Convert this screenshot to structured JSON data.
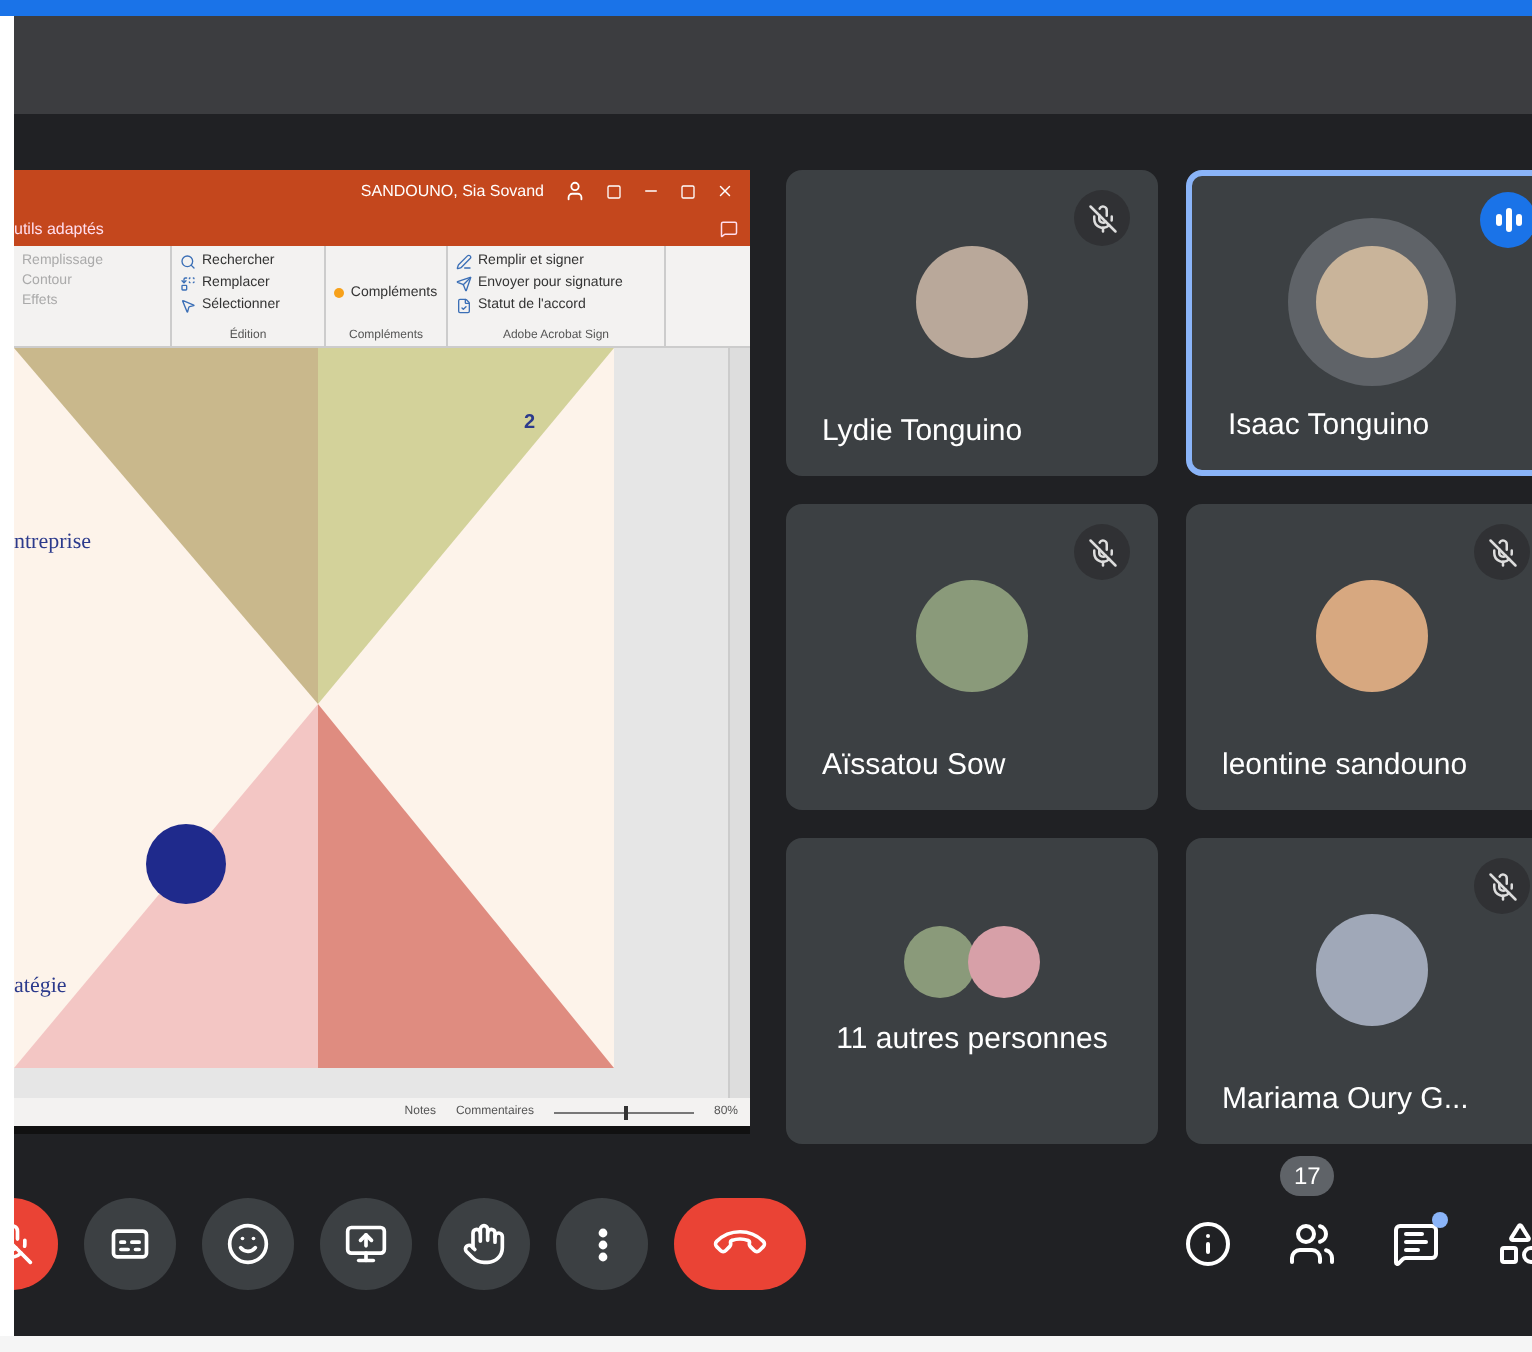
{
  "shared_screen": {
    "title_bar": {
      "user": "SANDOUNO, Sia Sovand"
    },
    "ribbon_tab": "utils adaptés",
    "ribbon_groups": [
      {
        "items": [
          "Remplissage",
          "Contour",
          "Effets"
        ]
      },
      {
        "label": "Édition",
        "items": [
          "Rechercher",
          "Remplacer",
          "Sélectionner"
        ]
      },
      {
        "label": "Compléments",
        "items": [
          "Compléments"
        ]
      },
      {
        "label": "Adobe Acrobat Sign",
        "items": [
          "Remplir et signer",
          "Envoyer pour signature",
          "Statut de l'accord"
        ]
      }
    ],
    "slide": {
      "texts": [
        "ntreprise",
        "atégie"
      ],
      "page_number": "2"
    },
    "status_bar": {
      "notes": "Notes",
      "comments": "Commentaires",
      "zoom": {
        "level": 0.5,
        "reading": "80%"
      }
    }
  },
  "participants": [
    {
      "name": "Lydie Tonguino",
      "kind": "single",
      "muted": true,
      "speaking": false
    },
    {
      "name": "Isaac Tonguino",
      "kind": "single",
      "muted": false,
      "speaking": true
    },
    {
      "name": "Aïssatou Sow",
      "kind": "single",
      "muted": true,
      "speaking": false
    },
    {
      "name": "leontine sandouno",
      "kind": "single",
      "muted": true,
      "speaking": false
    },
    {
      "name": "11 autres personnes",
      "kind": "group",
      "muted": false,
      "speaking": false
    },
    {
      "name": "Mariama Oury G...",
      "kind": "single",
      "muted": true,
      "speaking": false
    }
  ],
  "toolbar": {
    "controls": [
      {
        "kind": "mic"
      },
      {
        "kind": "captions"
      },
      {
        "kind": "emoji"
      },
      {
        "kind": "present"
      },
      {
        "kind": "hand"
      },
      {
        "kind": "more"
      },
      {
        "kind": "end"
      }
    ],
    "side": [
      {
        "kind": "info"
      },
      {
        "kind": "people",
        "badge": "17"
      },
      {
        "kind": "chat",
        "unread": true
      },
      {
        "kind": "activities"
      }
    ]
  }
}
